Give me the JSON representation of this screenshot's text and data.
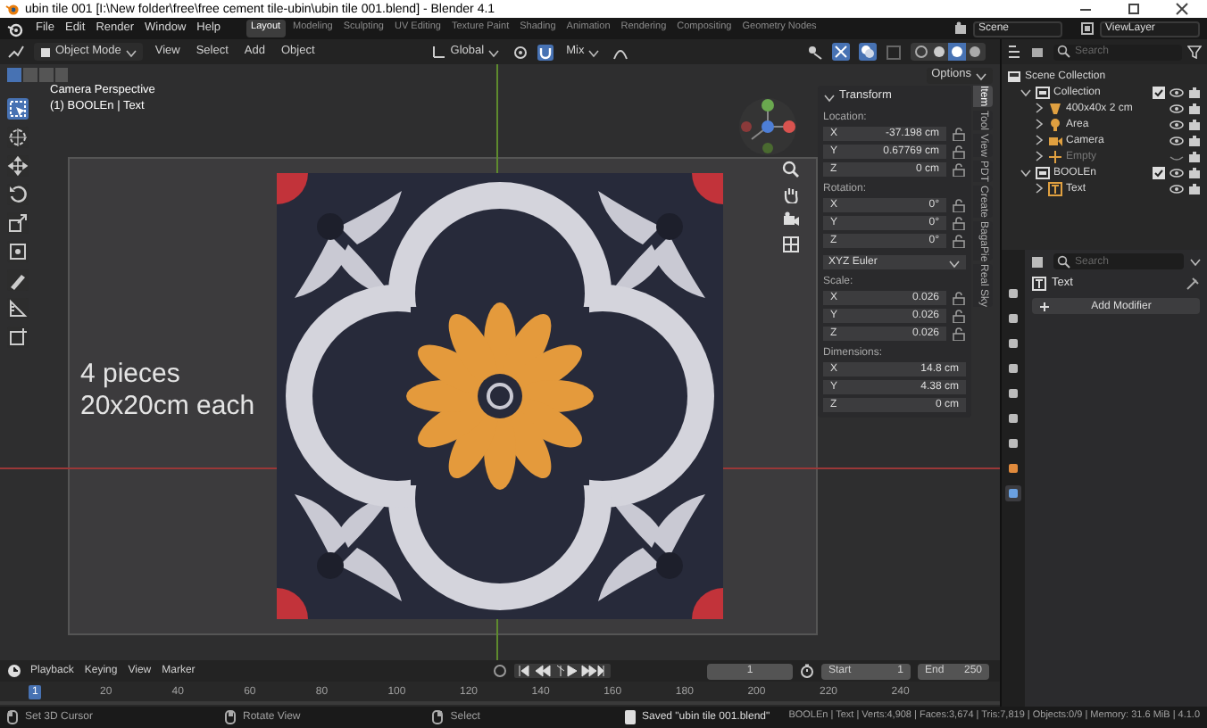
{
  "window": {
    "title": "ubin tile 001 [I:\\New folder\\free\\free cement tile-ubin\\ubin tile 001.blend] - Blender 4.1"
  },
  "menus": [
    "File",
    "Edit",
    "Render",
    "Window",
    "Help"
  ],
  "workspaces": [
    {
      "label": "Layout",
      "selected": true
    },
    {
      "label": "Modeling",
      "selected": false
    },
    {
      "label": "Sculpting",
      "selected": false
    },
    {
      "label": "UV Editing",
      "selected": false
    },
    {
      "label": "Texture Paint",
      "selected": false
    },
    {
      "label": "Shading",
      "selected": false
    },
    {
      "label": "Animation",
      "selected": false
    },
    {
      "label": "Rendering",
      "selected": false
    },
    {
      "label": "Compositing",
      "selected": false
    },
    {
      "label": "Geometry Nodes",
      "selected": false
    }
  ],
  "scene": "Scene",
  "view_layer": "ViewLayer",
  "viewport_header": {
    "mode": "Object Mode",
    "menus": [
      "View",
      "Select",
      "Add",
      "Object"
    ],
    "orientation": "Global",
    "proportional": "Mix",
    "options": "Options"
  },
  "viewport": {
    "camera_label": "Camera Perspective",
    "object_label": "(1) BOOLEn | Text",
    "caption": [
      "4 pieces",
      "20x20cm each"
    ]
  },
  "tools": [
    {
      "kind": "select",
      "selected": true
    },
    {
      "kind": "cursor",
      "selected": false
    },
    {
      "kind": "move",
      "selected": false
    },
    {
      "kind": "rotate",
      "selected": false
    },
    {
      "kind": "scale",
      "selected": false
    },
    {
      "kind": "transform",
      "selected": false
    },
    {
      "kind": "annotate",
      "selected": false
    },
    {
      "kind": "measure",
      "selected": false
    },
    {
      "kind": "add",
      "selected": false
    }
  ],
  "sidebar": {
    "tabs": [
      {
        "label": "Item",
        "selected": true
      },
      {
        "label": "Tool",
        "selected": false
      },
      {
        "label": "View",
        "selected": false
      },
      {
        "label": "PDT",
        "selected": false
      },
      {
        "label": "Create",
        "selected": false
      },
      {
        "label": "BagaPie",
        "selected": false
      },
      {
        "label": "Real Sky",
        "selected": false
      }
    ],
    "panel": "Transform",
    "groups": [
      {
        "label": "Location:",
        "locks": true,
        "fields": [
          {
            "axis": "X",
            "value": "-37.198 cm"
          },
          {
            "axis": "Y",
            "value": "0.67769 cm"
          },
          {
            "axis": "Z",
            "value": "0 cm"
          }
        ]
      },
      {
        "label": "Rotation:",
        "locks": true,
        "fields": [
          {
            "axis": "X",
            "value": "0°"
          },
          {
            "axis": "Y",
            "value": "0°"
          },
          {
            "axis": "Z",
            "value": "0°"
          }
        ],
        "mode": "XYZ Euler"
      },
      {
        "label": "Scale:",
        "locks": true,
        "fields": [
          {
            "axis": "X",
            "value": "0.026"
          },
          {
            "axis": "Y",
            "value": "0.026"
          },
          {
            "axis": "Z",
            "value": "0.026"
          }
        ]
      },
      {
        "label": "Dimensions:",
        "locks": false,
        "fields": [
          {
            "axis": "X",
            "value": "14.8 cm"
          },
          {
            "axis": "Y",
            "value": "4.38 cm"
          },
          {
            "axis": "Z",
            "value": "0 cm"
          }
        ]
      }
    ]
  },
  "outliner": {
    "search_placeholder": "Search",
    "tree": [
      {
        "name": "Scene Collection",
        "kind": "scene",
        "children": [
          {
            "name": "Collection",
            "kind": "collection",
            "expanded": true,
            "checked": true,
            "visible": true,
            "children": [
              {
                "name": "400x40x 2 cm",
                "kind": "mesh",
                "expanded": false,
                "visible": true
              },
              {
                "name": "Area",
                "kind": "light",
                "expanded": false,
                "visible": true
              },
              {
                "name": "Camera",
                "kind": "camera",
                "expanded": false,
                "visible": true
              },
              {
                "name": "Empty",
                "kind": "empty",
                "expanded": false,
                "visible": false
              }
            ]
          },
          {
            "name": "BOOLEn",
            "kind": "collection",
            "expanded": true,
            "checked": true,
            "visible": true,
            "children": [
              {
                "name": "Text",
                "kind": "text",
                "expanded": false,
                "visible": true
              }
            ]
          }
        ]
      }
    ]
  },
  "properties": {
    "search_placeholder": "Search",
    "object": "Text",
    "add_modifier": "Add Modifier"
  },
  "timeline": {
    "menus": [
      "Playback",
      "Keying",
      "View",
      "Marker"
    ],
    "current_frame": "1",
    "start_label": "Start",
    "start": "1",
    "end_label": "End",
    "end": "250",
    "frame_marker": "1",
    "ticks": [
      "20",
      "40",
      "60",
      "80",
      "100",
      "120",
      "140",
      "160",
      "180",
      "200",
      "220",
      "240"
    ]
  },
  "status": {
    "hints": [
      "Set 3D Cursor",
      "Rotate View",
      "Select"
    ],
    "message": "Saved \"ubin tile 001.blend\"",
    "stats": "BOOLEn | Text | Verts:4,908 | Faces:3,674 | Tris:7,819 | Objects:0/9 | Memory: 31.6 MiB | 4.1.0"
  }
}
